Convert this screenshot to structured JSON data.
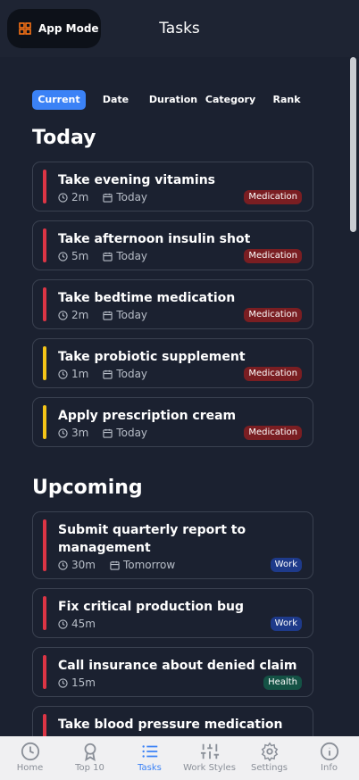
{
  "header": {
    "app_mode_label": "App Mode",
    "title": "Tasks"
  },
  "filters": [
    {
      "label": "Current",
      "active": true
    },
    {
      "label": "Date",
      "active": false
    },
    {
      "label": "Duration",
      "active": false
    },
    {
      "label": "Category",
      "active": false
    },
    {
      "label": "Rank",
      "active": false
    }
  ],
  "sections": [
    {
      "title": "Today",
      "tasks": [
        {
          "name": "Take evening vitamins",
          "duration": "2m",
          "date": "Today",
          "category": "Medication",
          "priority_color": "#dc3545"
        },
        {
          "name": "Take afternoon insulin shot",
          "duration": "5m",
          "date": "Today",
          "category": "Medication",
          "priority_color": "#dc3545"
        },
        {
          "name": "Take bedtime medication",
          "duration": "2m",
          "date": "Today",
          "category": "Medication",
          "priority_color": "#dc3545"
        },
        {
          "name": "Take probiotic supplement",
          "duration": "1m",
          "date": "Today",
          "category": "Medication",
          "priority_color": "#f5c518"
        },
        {
          "name": "Apply prescription cream",
          "duration": "3m",
          "date": "Today",
          "category": "Medication",
          "priority_color": "#f5c518"
        }
      ]
    },
    {
      "title": "Upcoming",
      "tasks": [
        {
          "name": "Submit quarterly report to management",
          "duration": "30m",
          "date": "Tomorrow",
          "category": "Work",
          "priority_color": "#dc3545"
        },
        {
          "name": "Fix critical production bug",
          "duration": "45m",
          "date": "",
          "category": "Work",
          "priority_color": "#dc3545"
        },
        {
          "name": "Call insurance about denied claim",
          "duration": "15m",
          "date": "",
          "category": "Health",
          "priority_color": "#dc3545"
        },
        {
          "name": "Take blood pressure medication",
          "duration": "",
          "date": "",
          "category": "",
          "priority_color": "#dc3545"
        }
      ]
    }
  ],
  "nav": [
    {
      "label": "Home",
      "icon": "clock-icon",
      "active": false
    },
    {
      "label": "Top 10",
      "icon": "award-icon",
      "active": false
    },
    {
      "label": "Tasks",
      "icon": "list-icon",
      "active": true
    },
    {
      "label": "Work Styles",
      "icon": "sliders-icon",
      "active": false
    },
    {
      "label": "Settings",
      "icon": "gear-icon",
      "active": false
    },
    {
      "label": "Info",
      "icon": "info-icon",
      "active": false
    }
  ],
  "colors": {
    "accent": "#3b82f6",
    "app_mode_icon": "#f97316"
  }
}
